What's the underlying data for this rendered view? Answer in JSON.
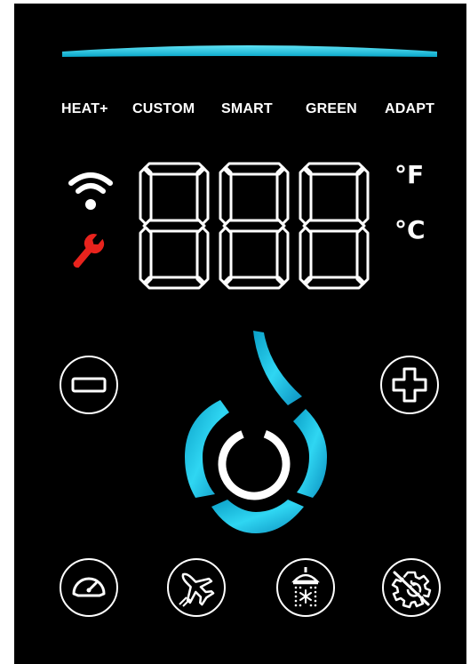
{
  "colors": {
    "accent": "#19c6e6",
    "accent_light": "#5fe3f5",
    "panel": "#000000",
    "foreground": "#ffffff",
    "wrench": "#e8231d"
  },
  "modes": [
    {
      "label": "HEAT+"
    },
    {
      "label": "CUSTOM"
    },
    {
      "label": "SMART"
    },
    {
      "label": "GREEN"
    },
    {
      "label": "ADAPT"
    }
  ],
  "display": {
    "readout": "888",
    "unit_f": "°F",
    "unit_c": "°C"
  },
  "icons": {
    "wifi": "wifi-icon",
    "wrench": "wrench-icon",
    "minus": "minus-icon",
    "plus": "plus-icon",
    "power": "power-icon",
    "gauge": "speedometer-icon",
    "vacation": "airplane-icon",
    "shower": "shower-icon",
    "settings": "gear-undo-icon"
  }
}
